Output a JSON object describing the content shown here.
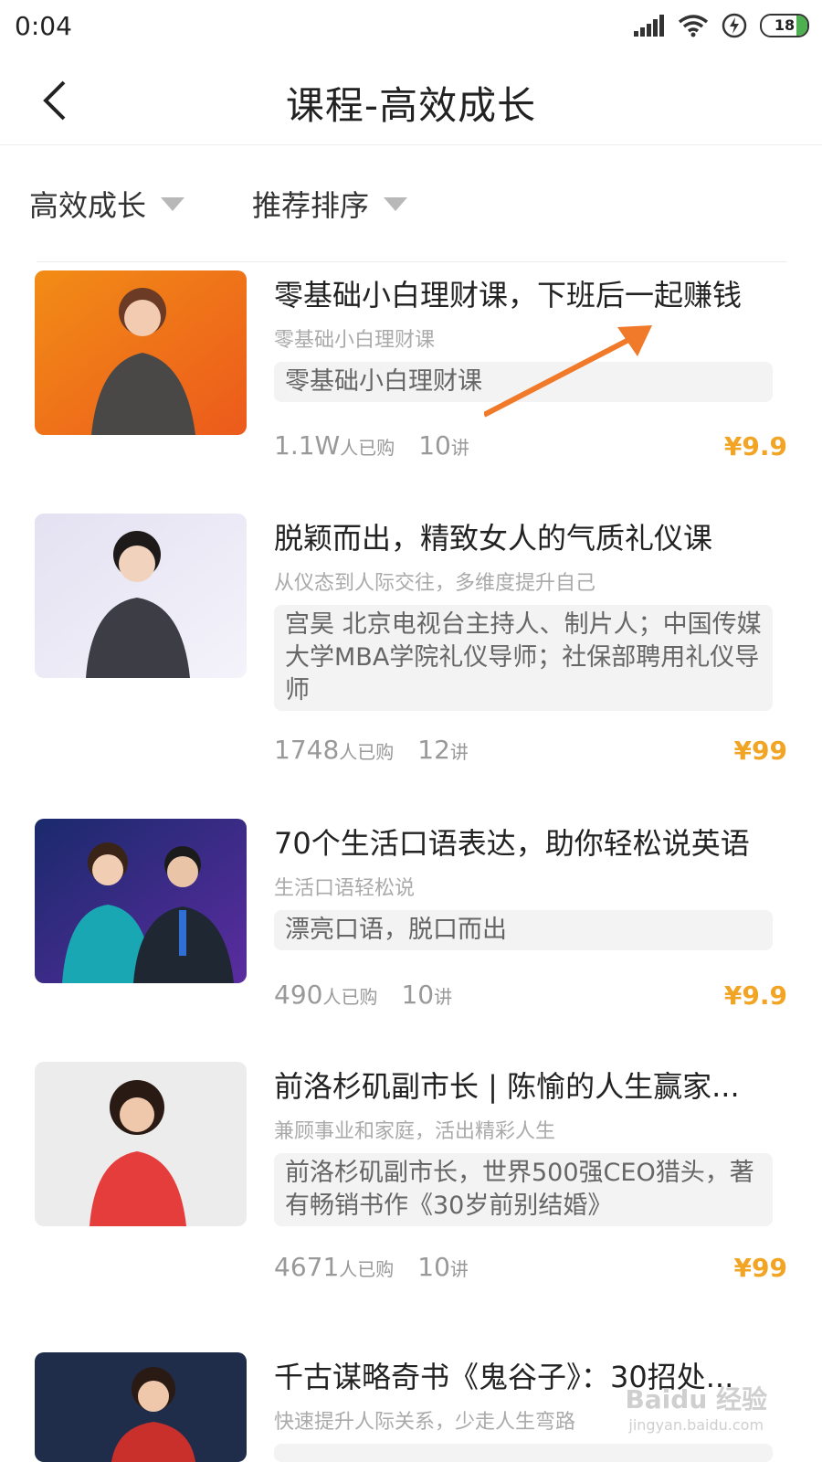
{
  "status": {
    "time": "0:04",
    "battery": "18"
  },
  "nav": {
    "title": "课程-高效成长"
  },
  "filters": [
    {
      "label": "高效成长"
    },
    {
      "label": "推荐排序"
    }
  ],
  "items": [
    {
      "title": "零基础小白理财课，下班后一起赚钱",
      "subtitle": "零基础小白理财课",
      "tag": "零基础小白理财课",
      "buyers": "1.1W",
      "buyers_suffix": "人已购",
      "lessons": "10",
      "lessons_suffix": "讲",
      "price": "¥9.9"
    },
    {
      "title": "脱颖而出，精致女人的气质礼仪课",
      "subtitle": "从仪态到人际交往，多维度提升自己",
      "tag": "宫昊  北京电视台主持人、制片人；中国传媒大学MBA学院礼仪导师；社保部聘用礼仪导师",
      "buyers": "1748",
      "buyers_suffix": "人已购",
      "lessons": "12",
      "lessons_suffix": "讲",
      "price": "¥99"
    },
    {
      "title": "70个生活口语表达，助你轻松说英语",
      "subtitle": "生活口语轻松说",
      "tag": "漂亮口语，脱口而出",
      "buyers": "490",
      "buyers_suffix": "人已购",
      "lessons": "10",
      "lessons_suffix": "讲",
      "price": "¥9.9"
    },
    {
      "title": "前洛杉矶副市长 | 陈愉的人生赢家...",
      "subtitle": "兼顾事业和家庭，活出精彩人生",
      "tag": "前洛杉矶副市长，世界500强CEO猎头，著有畅销书作《30岁前别结婚》",
      "buyers": "4671",
      "buyers_suffix": "人已购",
      "lessons": "10",
      "lessons_suffix": "讲",
      "price": "¥99"
    },
    {
      "title": "千古谋略奇书《鬼谷子》：30招处...",
      "subtitle": "快速提升人际关系，少走人生弯路"
    }
  ],
  "watermark": {
    "main": "Baidu 经验",
    "sub": "jingyan.baidu.com"
  },
  "colors": {
    "accent_price": "#f2a524",
    "annotation_arrow": "#f07a2a"
  }
}
